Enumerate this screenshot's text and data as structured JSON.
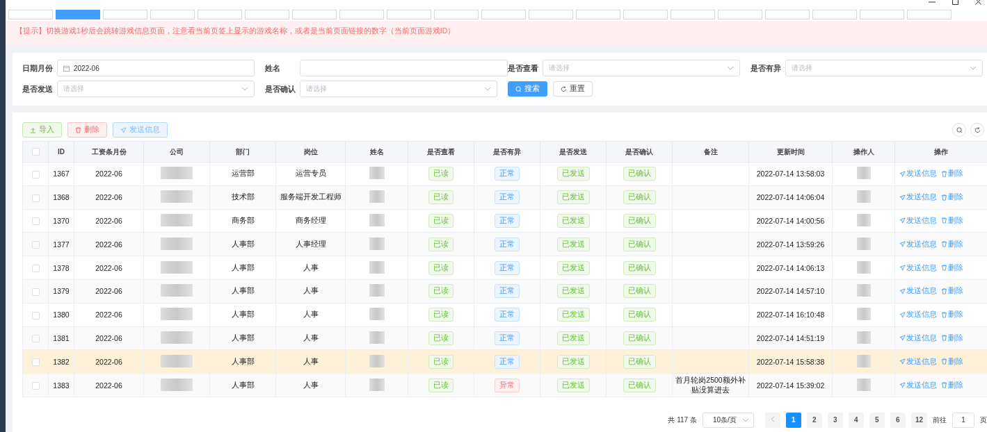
{
  "tabs": [
    {
      "selected": false
    },
    {
      "selected": true
    },
    {
      "selected": false
    },
    {
      "selected": false
    },
    {
      "selected": false
    },
    {
      "selected": false
    },
    {
      "selected": false
    },
    {
      "selected": false
    },
    {
      "selected": false
    },
    {
      "selected": false
    },
    {
      "selected": false
    },
    {
      "selected": false
    },
    {
      "selected": false
    },
    {
      "selected": false
    },
    {
      "selected": false
    },
    {
      "selected": false
    },
    {
      "selected": false
    },
    {
      "selected": false
    },
    {
      "selected": false
    },
    {
      "selected": false
    }
  ],
  "notice": "【提示】切换游戏1秒后会跳转游戏信息页面，注意看当前页签上显示的游戏名称，或者是当前页面链接的数字（当前页面游戏ID）",
  "filters": [
    {
      "label": "日期月份",
      "kind": "date",
      "value": "2022-06"
    },
    {
      "label": "姓名",
      "kind": "text"
    },
    {
      "label": "是否查看",
      "kind": "select",
      "placeholder": "请选择"
    },
    {
      "label": "是否有异",
      "kind": "select",
      "placeholder": "请选择"
    },
    {
      "label": "是否发送",
      "kind": "select",
      "placeholder": "请选择"
    },
    {
      "label": "是否确认",
      "kind": "select",
      "placeholder": "请选择"
    }
  ],
  "filter_buttons": [
    {
      "label": "搜索",
      "kind": "primary"
    },
    {
      "label": "重置",
      "kind": "plain"
    }
  ],
  "toolbar": [
    {
      "label": "导入",
      "kind": "success"
    },
    {
      "label": "删除",
      "kind": "danger"
    },
    {
      "label": "发送信息",
      "kind": "primary"
    }
  ],
  "table": {
    "select_all": {
      "checked": false
    },
    "columns": [
      "ID",
      "工资条月份",
      "公司",
      "部门",
      "岗位",
      "姓名",
      "是否查看",
      "是否有异",
      "是否发送",
      "是否确认",
      "备注",
      "更新时间",
      "操作人",
      "操作"
    ],
    "rows": [
      {
        "checked": false,
        "id": "1367",
        "month": "2022-06",
        "dept": "运营部",
        "post": "运营专员",
        "viewed": {
          "text": "已读",
          "kind": "success"
        },
        "abnormal": {
          "text": "正常",
          "kind": "info"
        },
        "sent": {
          "text": "已发送",
          "kind": "success"
        },
        "confirmed": {
          "text": "已确认",
          "kind": "success"
        },
        "updated": "2022-07-14 13:58:03",
        "actions": [
          "发送信息",
          "删除"
        ],
        "highlighted": false
      },
      {
        "checked": false,
        "id": "1368",
        "month": "2022-06",
        "dept": "技术部",
        "post": "服务端开发工程师",
        "viewed": {
          "text": "已读",
          "kind": "success"
        },
        "abnormal": {
          "text": "正常",
          "kind": "info"
        },
        "sent": {
          "text": "已发送",
          "kind": "success"
        },
        "confirmed": {
          "text": "已确认",
          "kind": "success"
        },
        "updated": "2022-07-14 14:06:04",
        "actions": [
          "发送信息",
          "删除"
        ],
        "highlighted": false
      },
      {
        "checked": false,
        "id": "1370",
        "month": "2022-06",
        "dept": "商务部",
        "post": "商务经理",
        "viewed": {
          "text": "已读",
          "kind": "success"
        },
        "abnormal": {
          "text": "正常",
          "kind": "info"
        },
        "sent": {
          "text": "已发送",
          "kind": "success"
        },
        "confirmed": {
          "text": "已确认",
          "kind": "success"
        },
        "updated": "2022-07-14 14:00:56",
        "actions": [
          "发送信息",
          "删除"
        ],
        "highlighted": false
      },
      {
        "checked": false,
        "id": "1377",
        "month": "2022-06",
        "dept": "人事部",
        "post": "人事经理",
        "viewed": {
          "text": "已读",
          "kind": "success"
        },
        "abnormal": {
          "text": "正常",
          "kind": "info"
        },
        "sent": {
          "text": "已发送",
          "kind": "success"
        },
        "confirmed": {
          "text": "已确认",
          "kind": "success"
        },
        "updated": "2022-07-14 13:59:26",
        "actions": [
          "发送信息",
          "删除"
        ],
        "highlighted": false
      },
      {
        "checked": false,
        "id": "1378",
        "month": "2022-06",
        "dept": "人事部",
        "post": "人事",
        "viewed": {
          "text": "已读",
          "kind": "success"
        },
        "abnormal": {
          "text": "正常",
          "kind": "info"
        },
        "sent": {
          "text": "已发送",
          "kind": "success"
        },
        "confirmed": {
          "text": "已确认",
          "kind": "success"
        },
        "updated": "2022-07-14 14:06:13",
        "actions": [
          "发送信息",
          "删除"
        ],
        "highlighted": false
      },
      {
        "checked": false,
        "id": "1379",
        "month": "2022-06",
        "dept": "人事部",
        "post": "人事",
        "viewed": {
          "text": "已读",
          "kind": "success"
        },
        "abnormal": {
          "text": "正常",
          "kind": "info"
        },
        "sent": {
          "text": "已发送",
          "kind": "success"
        },
        "confirmed": {
          "text": "已确认",
          "kind": "success"
        },
        "updated": "2022-07-14 14:57:10",
        "actions": [
          "发送信息",
          "删除"
        ],
        "highlighted": false
      },
      {
        "checked": false,
        "id": "1380",
        "month": "2022-06",
        "dept": "人事部",
        "post": "人事",
        "viewed": {
          "text": "已读",
          "kind": "success"
        },
        "abnormal": {
          "text": "正常",
          "kind": "info"
        },
        "sent": {
          "text": "已发送",
          "kind": "success"
        },
        "confirmed": {
          "text": "已确认",
          "kind": "success"
        },
        "updated": "2022-07-14 16:10:48",
        "actions": [
          "发送信息",
          "删除"
        ],
        "highlighted": false
      },
      {
        "checked": false,
        "id": "1381",
        "month": "2022-06",
        "dept": "人事部",
        "post": "人事",
        "viewed": {
          "text": "已读",
          "kind": "success"
        },
        "abnormal": {
          "text": "正常",
          "kind": "info"
        },
        "sent": {
          "text": "已发送",
          "kind": "success"
        },
        "confirmed": {
          "text": "已确认",
          "kind": "success"
        },
        "updated": "2022-07-14 14:51:19",
        "actions": [
          "发送信息",
          "删除"
        ],
        "highlighted": false
      },
      {
        "checked": false,
        "id": "1382",
        "month": "2022-06",
        "dept": "人事部",
        "post": "人事",
        "viewed": {
          "text": "已读",
          "kind": "success"
        },
        "abnormal": {
          "text": "正常",
          "kind": "info"
        },
        "sent": {
          "text": "已发送",
          "kind": "success"
        },
        "confirmed": {
          "text": "已确认",
          "kind": "success"
        },
        "updated": "2022-07-14 15:58:38",
        "actions": [
          "发送信息",
          "删除"
        ],
        "highlighted": true
      },
      {
        "checked": false,
        "id": "1383",
        "month": "2022-06",
        "dept": "人事部",
        "post": "人事",
        "viewed": {
          "text": "已读",
          "kind": "success"
        },
        "abnormal": {
          "text": "异常",
          "kind": "danger"
        },
        "sent": {
          "text": "已发送",
          "kind": "success"
        },
        "confirmed": {
          "text": "已确认",
          "kind": "success"
        },
        "note": "首月轮岗2500额外补贴没算进去",
        "updated": "2022-07-14 15:39:02",
        "actions": [
          "发送信息",
          "删除"
        ],
        "highlighted": false
      }
    ]
  },
  "pagination": {
    "total": "共 117 条",
    "page_size": "10条/页",
    "pages": [
      {
        "label": "1",
        "selected": true
      },
      {
        "label": "2",
        "selected": false
      },
      {
        "label": "3",
        "selected": false
      },
      {
        "label": "4",
        "selected": false
      },
      {
        "label": "5",
        "selected": false
      },
      {
        "label": "6",
        "selected": false
      },
      {
        "label": "12",
        "selected": false
      }
    ],
    "goto_label": "前往",
    "goto_value": "1",
    "goto_suffix": "页"
  }
}
